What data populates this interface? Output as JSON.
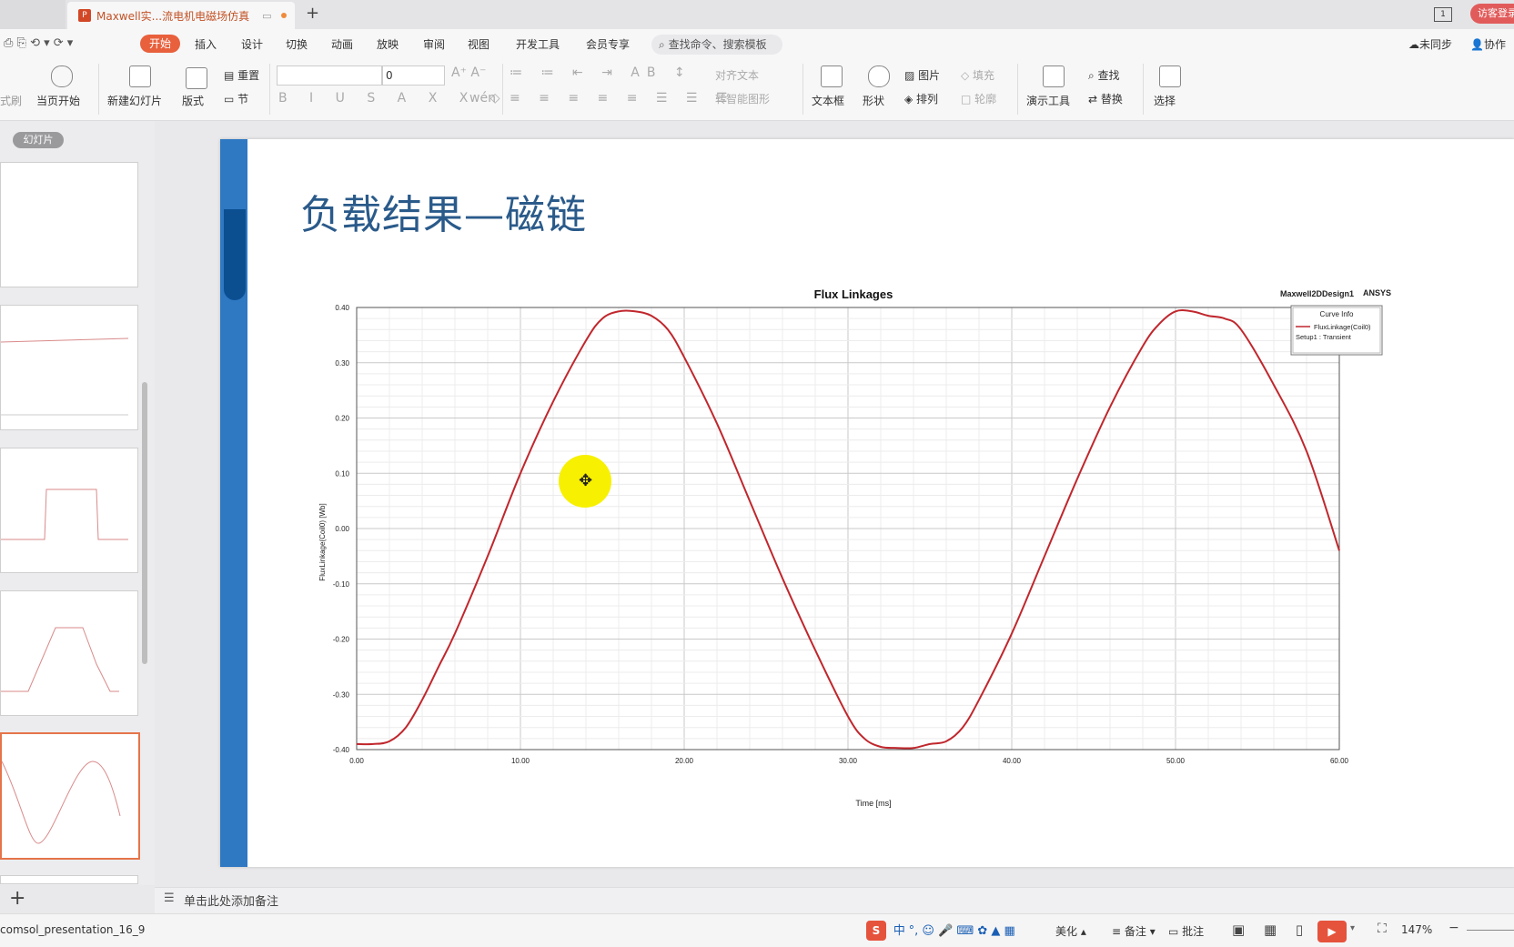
{
  "tabbar": {
    "doc_title": "Maxwell实...流电机电磁场仿真",
    "guest": "访客登录",
    "win_count": "1"
  },
  "menu": {
    "items": [
      "开始",
      "插入",
      "设计",
      "切换",
      "动画",
      "放映",
      "审阅",
      "视图",
      "开发工具",
      "会员专享"
    ],
    "search_placeholder": "查找命令、搜索模板",
    "sync": "未同步",
    "collab": "协作"
  },
  "ribbon": {
    "format_painter": "式刷",
    "from_start": "当页开始",
    "new_slide": "新建幻灯片",
    "layout": "版式",
    "reset": "重置",
    "section": "节",
    "font_size": "0",
    "align_text": "对齐文本",
    "smart_art": "转智能图形",
    "textbox": "文本框",
    "shape": "形状",
    "picture": "图片",
    "fill": "填充",
    "arrange": "排列",
    "outline": "轮廓",
    "presenter_tools": "演示工具",
    "find": "查找",
    "replace": "替换",
    "select": "选择"
  },
  "thumbs": {
    "label": "幻灯片"
  },
  "slide": {
    "title": "负载结果—磁链"
  },
  "notes": {
    "placeholder": "单击此处添加备注"
  },
  "status": {
    "file": "comsol_presentation_16_9",
    "beautify": "美化",
    "comments": "备注",
    "annotate": "批注",
    "zoom": "147%",
    "ime": "中"
  },
  "colors": {
    "accent": "#e8603c",
    "slide_bar": "#2f78c2",
    "curve": "#c0272d"
  },
  "chart_data": {
    "type": "line",
    "title": "Flux Linkages",
    "design": "Maxwell2DDesign1",
    "brand": "ANSYS",
    "xlabel": "Time [ms]",
    "ylabel": "FluxLinkage(Coil0) [Wb]",
    "xlim": [
      0,
      60
    ],
    "ylim": [
      -0.4,
      0.4
    ],
    "xticks": [
      "0.00",
      "10.00",
      "20.00",
      "30.00",
      "40.00",
      "50.00",
      "60.00"
    ],
    "yticks": [
      "0.40",
      "0.30",
      "0.20",
      "0.10",
      "0.00",
      "-0.10",
      "-0.20",
      "-0.30",
      "-0.40"
    ],
    "grid": true,
    "legend": {
      "title": "Curve Info",
      "placement": "top-right",
      "entries": [
        "FluxLinkage(Coil0)"
      ],
      "subtitle": "Setup1 : Transient"
    },
    "series": [
      {
        "name": "FluxLinkage(Coil0)",
        "x": [
          0,
          1,
          2,
          3,
          4,
          5,
          6,
          8,
          10,
          12,
          14,
          15,
          16,
          17,
          18,
          19,
          20,
          22,
          24,
          26,
          28,
          30,
          31,
          32,
          33,
          34,
          35,
          36,
          37,
          38,
          40,
          42,
          44,
          46,
          48,
          49,
          50,
          51,
          52,
          53,
          54,
          56,
          58,
          60
        ],
        "y": [
          -0.39,
          -0.39,
          -0.385,
          -0.36,
          -0.31,
          -0.25,
          -0.19,
          -0.05,
          0.1,
          0.23,
          0.34,
          0.38,
          0.393,
          0.393,
          0.385,
          0.36,
          0.31,
          0.19,
          0.05,
          -0.09,
          -0.22,
          -0.34,
          -0.38,
          -0.395,
          -0.397,
          -0.397,
          -0.39,
          -0.385,
          -0.36,
          -0.31,
          -0.19,
          -0.05,
          0.09,
          0.22,
          0.33,
          0.37,
          0.393,
          0.393,
          0.385,
          0.38,
          0.36,
          0.26,
          0.14,
          -0.04
        ]
      }
    ]
  }
}
